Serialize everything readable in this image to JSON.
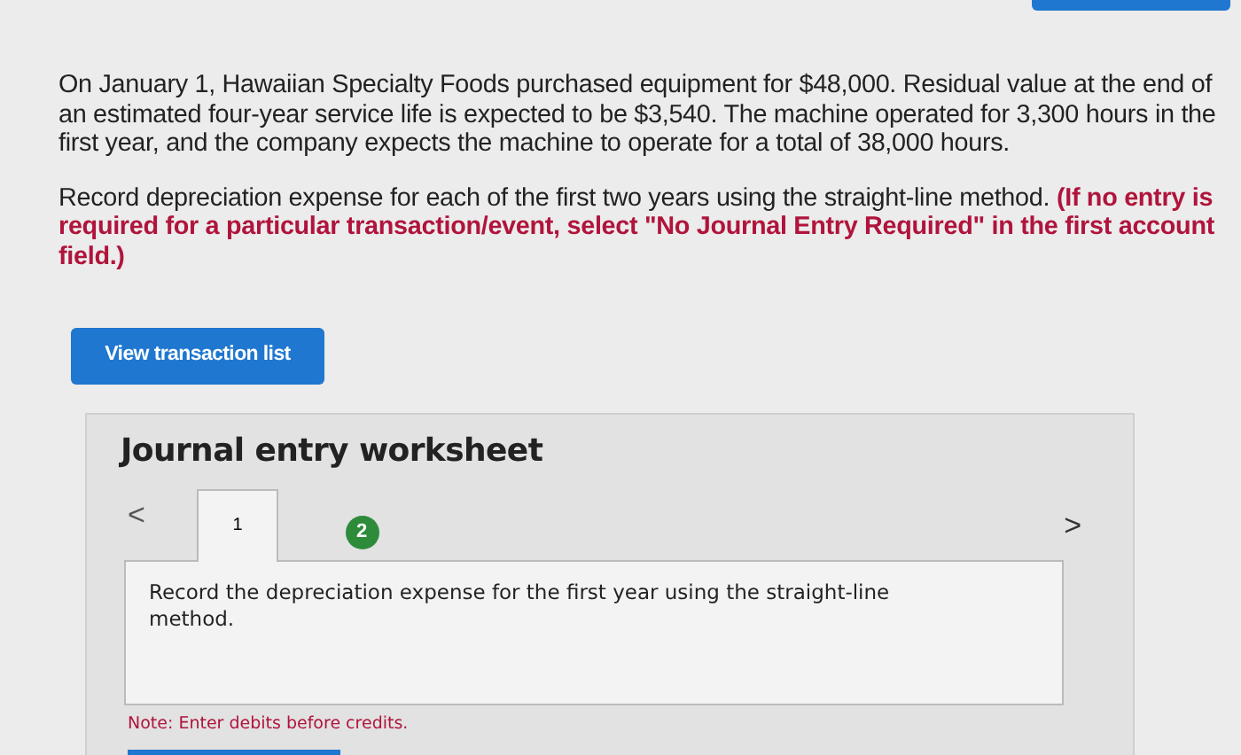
{
  "problem": {
    "paragraphs": [
      {
        "text": "On January 1, Hawaiian Specialty Foods purchased equipment for $48,000. Residual value at the end of an estimated four-year service life is expected to be $3,540. The machine operated for 3,300 hours in the first year, and the company expects the machine to operate for a total of 38,000 hours."
      },
      {
        "text": "Record depreciation expense for each of the first two years using the straight-line method.",
        "emphasis": "(If no entry is required for a particular transaction/event, select \"No Journal Entry Required\" in the first account field.)"
      }
    ]
  },
  "view_button": "View transaction list",
  "worksheet": {
    "title": "Journal entry worksheet",
    "prev": "<",
    "next": ">",
    "tabs": [
      {
        "label": "1",
        "selected": true,
        "completed": false
      },
      {
        "label": "2",
        "selected": false,
        "completed": true
      }
    ],
    "instruction": "Record the depreciation expense for the first year using the straight-line method.",
    "note": "Note: Enter debits before credits."
  }
}
